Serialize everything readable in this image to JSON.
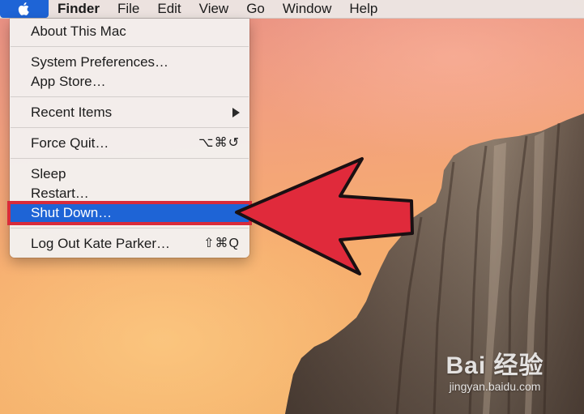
{
  "menubar": {
    "apple_icon": "apple-icon",
    "items": [
      "Finder",
      "File",
      "Edit",
      "View",
      "Go",
      "Window",
      "Help"
    ]
  },
  "apple_menu": {
    "about": "About This Mac",
    "system_preferences": "System Preferences…",
    "app_store": "App Store…",
    "recent_items": "Recent Items",
    "recent_items_submenu_icon": "submenu-triangle-icon",
    "force_quit": "Force Quit…",
    "force_quit_shortcut": "⌥⌘↺",
    "sleep": "Sleep",
    "restart": "Restart…",
    "shut_down": "Shut Down…",
    "log_out": "Log Out Kate Parker…",
    "log_out_shortcut": "⇧⌘Q"
  },
  "watermark": {
    "logo": "Bai 经验",
    "url": "jingyan.baidu.com"
  },
  "colors": {
    "selection": "#1e64d6",
    "highlight_box": "#d92b3a",
    "arrow": "#e02a3b"
  }
}
